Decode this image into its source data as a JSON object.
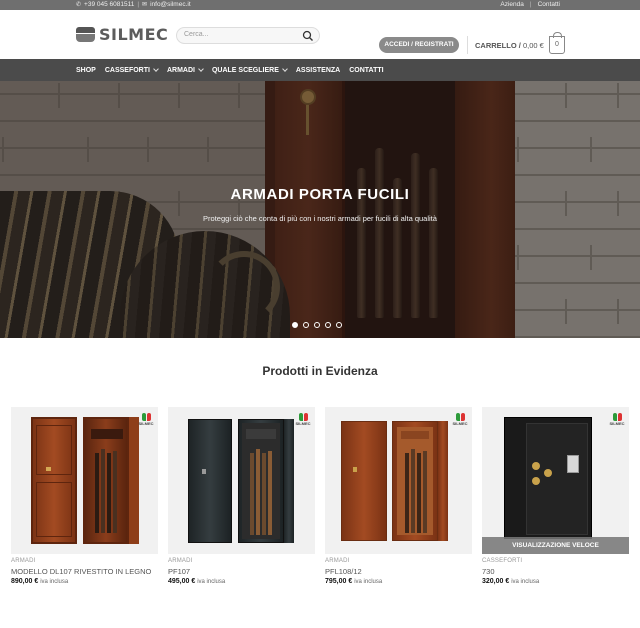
{
  "topbar": {
    "phone": "+39 045 6081511",
    "email": "info@silmec.it",
    "links": [
      "Azienda",
      "Contatti"
    ]
  },
  "header": {
    "logo_text": "SILMEC",
    "search_placeholder": "Cerca...",
    "login_label": "ACCEDI / REGISTRATI",
    "cart_label": "CARRELLO /",
    "cart_amount": "0,00 €",
    "cart_count": "0"
  },
  "nav": {
    "items": [
      {
        "label": "SHOP",
        "dropdown": false
      },
      {
        "label": "CASSEFORTI",
        "dropdown": true
      },
      {
        "label": "ARMADI",
        "dropdown": true
      },
      {
        "label": "QUALE SCEGLIERE",
        "dropdown": true
      },
      {
        "label": "ASSISTENZA",
        "dropdown": false
      },
      {
        "label": "CONTATTI",
        "dropdown": false
      }
    ]
  },
  "hero": {
    "title": "ARMADI PORTA FUCILI",
    "subtitle": "Proteggi ciò che conta di più con i nostri armadi per fucili di alta qualità",
    "slides_total": 5,
    "active_slide": 1
  },
  "featured": {
    "title": "Prodotti in Evidenza",
    "products": [
      {
        "category": "ARMADI",
        "name": "MODELLO DL107 RIVESTITO IN LEGNO",
        "price": "890,00 €",
        "tax_note": "iva inclusa",
        "brand": "SILMEC"
      },
      {
        "category": "ARMADI",
        "name": "PF107",
        "price": "495,00 €",
        "tax_note": "iva inclusa",
        "brand": "SILMEC"
      },
      {
        "category": "ARMADI",
        "name": "PFL108/12",
        "price": "795,00 €",
        "tax_note": "iva inclusa",
        "brand": "SILMEC"
      },
      {
        "category": "CASSEFORTI",
        "name": "730",
        "price": "320,00 €",
        "tax_note": "iva inclusa",
        "brand": "SILMEC",
        "quick_view": "VISUALIZZAZIONE VELOCE"
      }
    ]
  }
}
